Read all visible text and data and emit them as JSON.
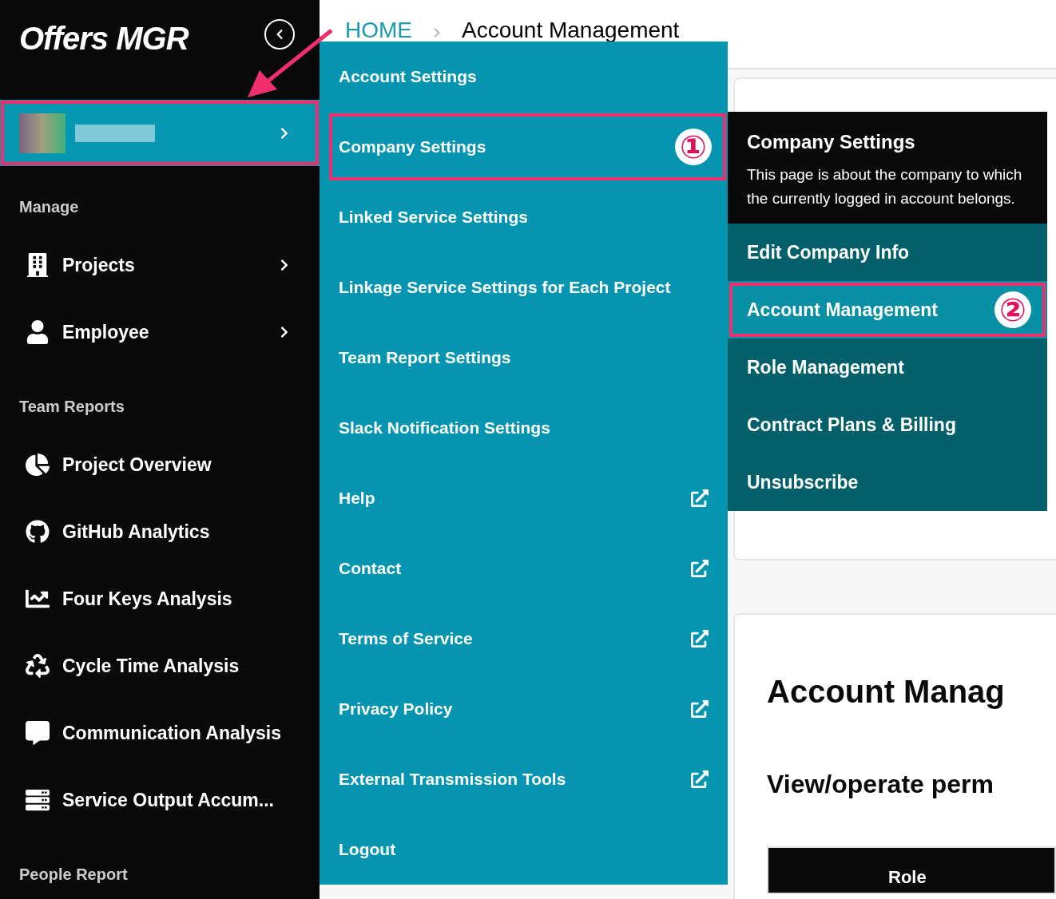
{
  "sidebar": {
    "logo": "Offers MGR",
    "user_row": {
      "highlighted": true
    },
    "sections": [
      {
        "title": "Manage",
        "items": [
          {
            "label": "Projects",
            "kind": "submenu"
          },
          {
            "label": "Employee",
            "kind": "submenu"
          }
        ]
      },
      {
        "title": "Team Reports",
        "items": [
          {
            "label": "Project Overview",
            "kind": "link"
          },
          {
            "label": "GitHub Analytics",
            "kind": "link"
          },
          {
            "label": "Four Keys Analysis",
            "kind": "link"
          },
          {
            "label": "Cycle Time Analysis",
            "kind": "link"
          },
          {
            "label": "Communication Analysis",
            "kind": "link"
          },
          {
            "label": "Service Output Accum...",
            "kind": "link"
          }
        ]
      },
      {
        "title": "People Report"
      }
    ]
  },
  "breadcrumb": [
    {
      "label": "HOME",
      "kind": "link"
    },
    {
      "label": "Account Management",
      "kind": "current"
    }
  ],
  "menu": {
    "items": [
      {
        "label": "Account Settings",
        "kind": "page",
        "highlighted": false
      },
      {
        "label": "Company Settings",
        "kind": "page",
        "highlighted": true,
        "marker": "①"
      },
      {
        "label": "Linked Service Settings",
        "kind": "page",
        "highlighted": false
      },
      {
        "label": "Linkage Service Settings for Each Project",
        "kind": "page",
        "highlighted": false
      },
      {
        "label": "Team Report Settings",
        "kind": "page",
        "highlighted": false
      },
      {
        "label": "Slack Notification Settings",
        "kind": "page",
        "highlighted": false
      },
      {
        "label": "Help",
        "kind": "external",
        "highlighted": false
      },
      {
        "label": "Contact",
        "kind": "external",
        "highlighted": false
      },
      {
        "label": "Terms of Service",
        "kind": "external",
        "highlighted": false
      },
      {
        "label": "Privacy Policy",
        "kind": "external",
        "highlighted": false
      },
      {
        "label": "External Transmission Tools",
        "kind": "external",
        "highlighted": false
      },
      {
        "label": "Logout",
        "kind": "page",
        "highlighted": false
      }
    ]
  },
  "submenu": {
    "title": "Company Settings",
    "description": "This page is about the company to which the currently logged in account belongs.",
    "items": [
      {
        "label": "Edit Company Info",
        "selected": false
      },
      {
        "label": "Account Management",
        "selected": true,
        "marker": "②"
      },
      {
        "label": "Role Management",
        "selected": false
      },
      {
        "label": "Contract Plans & Billing",
        "selected": false
      },
      {
        "label": "Unsubscribe",
        "selected": false
      }
    ]
  },
  "content": {
    "heading": "Account Manag",
    "subheading": "View/operate perm",
    "table": {
      "columns": [
        "Role"
      ]
    }
  }
}
